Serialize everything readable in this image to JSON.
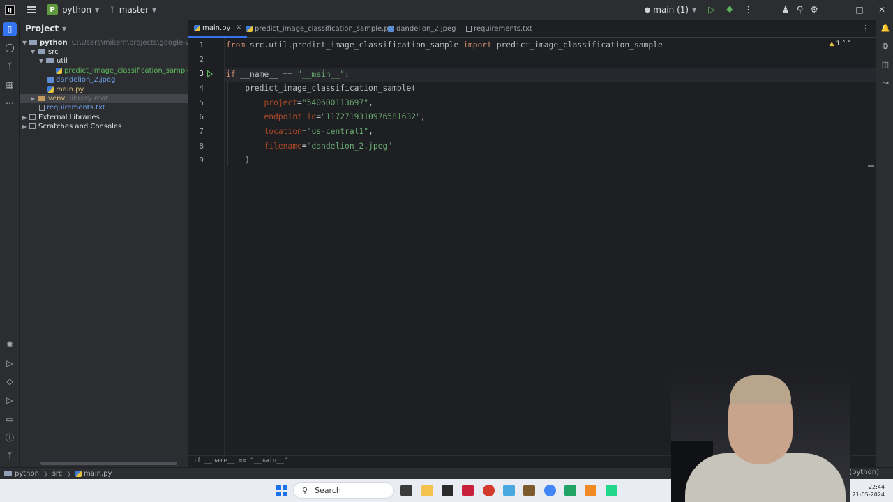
{
  "titlebar": {
    "project_badge": "P",
    "project_name": "python",
    "branch": "master",
    "run_config": "main (1)",
    "logo_text": "IJ"
  },
  "project_panel": {
    "title": "Project",
    "root_name": "python",
    "root_path": "C:\\Users\\mikem\\projects\\google-vertext-d",
    "src": "src",
    "util": "util",
    "util_file": "predict_image_classification_sample.py",
    "image_file": "dandelion_2.jpeg",
    "main_file": "main.py",
    "venv": "venv",
    "venv_tag": "library root",
    "requirements": "requirements.txt",
    "external_libraries": "External Libraries",
    "scratches": "Scratches and Consoles"
  },
  "tabs": [
    {
      "label": "main.py"
    },
    {
      "label": "predict_image_classification_sample.py"
    },
    {
      "label": "dandelion_2.jpeg"
    },
    {
      "label": "requirements.txt"
    }
  ],
  "editor": {
    "line_numbers": [
      "1",
      "2",
      "3",
      "4",
      "5",
      "6",
      "7",
      "8",
      "9"
    ],
    "warning_count": "1",
    "line1": {
      "from": "from",
      "module": " src.util.predict_image_classification_sample ",
      "import": "import",
      "name": " predict_image_classification_sample"
    },
    "line3": {
      "if": "if",
      "cond": " __name__ == ",
      "str": "\"__main__\"",
      "colon": ":"
    },
    "line4": {
      "call": "    predict_image_classification_sample("
    },
    "line5": {
      "param": "        project",
      "eq": "=",
      "val": "\"540600113697\"",
      "comma": ","
    },
    "line6": {
      "param": "        endpoint_id",
      "eq": "=",
      "val": "\"1172719310976581632\"",
      "comma": ","
    },
    "line7": {
      "param": "        location",
      "eq": "=",
      "val": "\"us-central1\"",
      "comma": ","
    },
    "line8": {
      "param": "        filename",
      "eq": "=",
      "val": "\"dandelion_2.jpeg\""
    },
    "line9": {
      "close": "    )"
    }
  },
  "breadcrumb": "if __name__ == \"__main__\"",
  "statusbar": {
    "project": "python",
    "src": "src",
    "file": "main.py",
    "interpreter": "11 (python)"
  },
  "taskbar": {
    "search_placeholder": "Search",
    "time": "22:44",
    "date": "21-05-2024"
  },
  "colors": {
    "accent": "#3574f0",
    "run_green": "#5fb85f",
    "keyword": "#cf8e6d",
    "string": "#6aab73",
    "param": "#aa4926"
  },
  "icons": [
    "hamburger-icon",
    "branch-icon",
    "run-icon",
    "debug-icon",
    "more-icon",
    "add-user-icon",
    "search-icon",
    "settings-icon",
    "minimize-icon",
    "maximize-icon",
    "close-icon",
    "folder-icon",
    "python-file-icon",
    "windows-icon"
  ]
}
